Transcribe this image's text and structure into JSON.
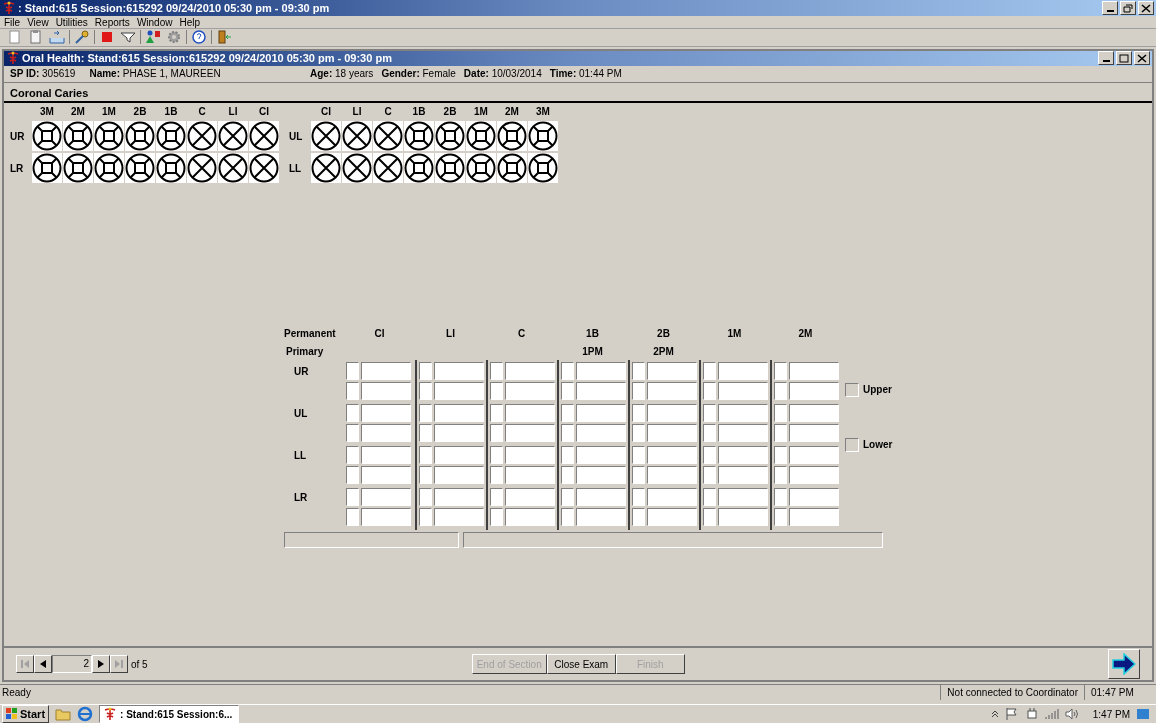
{
  "app_title": ": Stand:615 Session:615292 09/24/2010 05:30 pm - 09:30 pm",
  "menu": [
    "File",
    "View",
    "Utilities",
    "Reports",
    "Window",
    "Help"
  ],
  "document": {
    "title": "Oral Health: Stand:615 Session:615292 09/24/2010 05:30 pm - 09:30 pm",
    "info_left": [
      {
        "label": "SP ID:",
        "value": "305619"
      },
      {
        "label": "Name:",
        "value": "PHASE 1, MAUREEN"
      }
    ],
    "info_right": [
      {
        "label": "Age:",
        "value": "18 years"
      },
      {
        "label": "Gender:",
        "value": "Female"
      },
      {
        "label": "Date:",
        "value": "10/03/2014"
      },
      {
        "label": "Time:",
        "value": "01:44 PM"
      }
    ]
  },
  "section_title": "Coronal Caries",
  "tooth_chart": [
    {
      "headers": [
        "3M",
        "2M",
        "1M",
        "2B",
        "1B",
        "C",
        "LI",
        "CI"
      ],
      "rows": [
        {
          "label": "UR",
          "teeth": [
            {
              "kind": "square"
            },
            {
              "kind": "square"
            },
            {
              "kind": "square"
            },
            {
              "kind": "square"
            },
            {
              "kind": "square"
            },
            {
              "kind": "x"
            },
            {
              "kind": "x"
            },
            {
              "kind": "x"
            }
          ]
        },
        {
          "label": "LR",
          "teeth": [
            {
              "kind": "square"
            },
            {
              "kind": "square"
            },
            {
              "kind": "square"
            },
            {
              "kind": "square"
            },
            {
              "kind": "square"
            },
            {
              "kind": "x"
            },
            {
              "kind": "x"
            },
            {
              "kind": "x"
            }
          ]
        }
      ]
    },
    {
      "headers": [
        "CI",
        "LI",
        "C",
        "1B",
        "2B",
        "1M",
        "2M",
        "3M"
      ],
      "rows": [
        {
          "label": "UL",
          "teeth": [
            {
              "kind": "x"
            },
            {
              "kind": "x"
            },
            {
              "kind": "x"
            },
            {
              "kind": "square"
            },
            {
              "kind": "square"
            },
            {
              "kind": "square"
            },
            {
              "kind": "square"
            },
            {
              "kind": "square"
            }
          ]
        },
        {
          "label": "LL",
          "teeth": [
            {
              "kind": "x"
            },
            {
              "kind": "x"
            },
            {
              "kind": "x"
            },
            {
              "kind": "square"
            },
            {
              "kind": "square"
            },
            {
              "kind": "square"
            },
            {
              "kind": "square"
            },
            {
              "kind": "square"
            }
          ]
        }
      ]
    }
  ],
  "grid": {
    "permanent_label": "Permanent",
    "primary_label": "Primary",
    "columns": [
      {
        "permanent": "CI"
      },
      {
        "permanent": "LI"
      },
      {
        "permanent": "C"
      },
      {
        "permanent": "1B",
        "primary": "1PM"
      },
      {
        "permanent": "2B",
        "primary": "2PM"
      },
      {
        "permanent": "1M"
      },
      {
        "permanent": "2M"
      }
    ],
    "quadrants": [
      "UR",
      "UL",
      "LL",
      "LR"
    ],
    "checks": [
      {
        "label": "Upper",
        "checked": false
      },
      {
        "label": "Lower",
        "checked": false
      }
    ]
  },
  "pager": {
    "page": "2",
    "of": "of 5",
    "first_disabled": true,
    "prev_disabled": false,
    "next_disabled": false,
    "last_disabled": true
  },
  "buttons": [
    {
      "label": "End of Section",
      "disabled": true
    },
    {
      "label": "Close Exam",
      "disabled": false
    },
    {
      "label": "Finish",
      "disabled": true
    }
  ],
  "status_bar": {
    "message": "Ready",
    "connection": "Not connected to Coordinator",
    "time": "01:47 PM"
  },
  "taskbar": {
    "start": "Start",
    "task": ": Stand:615 Session:6...",
    "clock": "1:47 PM"
  }
}
